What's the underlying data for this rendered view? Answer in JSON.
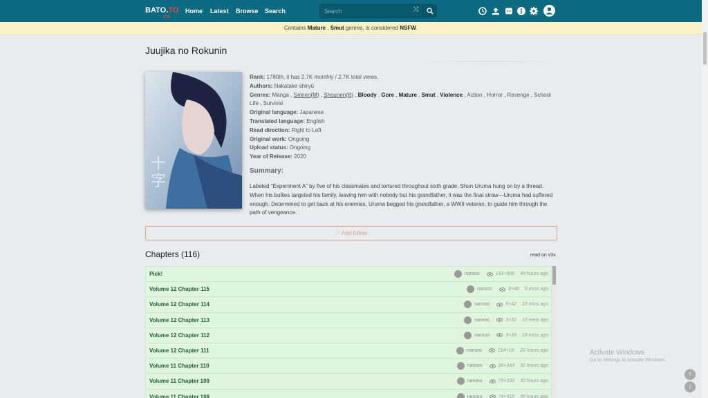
{
  "nav": {
    "logo_main": "BATO.",
    "logo_to": "TO",
    "logo_sub": "v3x",
    "links": [
      "Home",
      "Latest",
      "Browse",
      "Search"
    ],
    "search_placeholder": "Search"
  },
  "notice": {
    "pre": "Contains ",
    "g1": "Mature",
    "sep": " , ",
    "g2": "Smut",
    "mid": " genres, is considered ",
    "nsfw": "NSFW",
    "end": "."
  },
  "manga": {
    "title": "Juujika no Rokunin",
    "rank_label": "Rank:",
    "rank_value": "1780th, it has 2.7K monthly / 2.7K total views.",
    "authors_label": "Authors:",
    "authors_value": "Nakatake shiryū",
    "genres_label": "Genres:",
    "genres": [
      {
        "name": "Manga",
        "style": "plain"
      },
      {
        "name": "Seinen(M)",
        "style": "under"
      },
      {
        "name": "Shounen(B)",
        "style": "under"
      },
      {
        "name": "Bloody",
        "style": "bold"
      },
      {
        "name": "Gore",
        "style": "bold"
      },
      {
        "name": "Mature",
        "style": "bold"
      },
      {
        "name": "Smut",
        "style": "bold"
      },
      {
        "name": "Violence",
        "style": "bold"
      },
      {
        "name": "Action",
        "style": "plain"
      },
      {
        "name": "Horror",
        "style": "plain"
      },
      {
        "name": "Revenge",
        "style": "plain"
      },
      {
        "name": "School Life",
        "style": "plain"
      },
      {
        "name": "Survival",
        "style": "plain"
      }
    ],
    "orig_lang_label": "Original language:",
    "orig_lang_value": "Japanese",
    "trans_lang_label": "Translated language:",
    "trans_lang_value": "English",
    "read_dir_label": "Read direction:",
    "read_dir_value": "Right to Left",
    "orig_work_label": "Original work:",
    "orig_work_value": "Ongoing",
    "upload_label": "Upload status:",
    "upload_value": "Ongoing",
    "year_label": "Year of Release:",
    "year_value": "2020",
    "summary_title": "Summary:",
    "summary": "Labeled \"Experiment A\" by five of his classmates and tortured throughout sixth grade, Shun Uruma hung on by a thread. When his bullies targeted his family, leaving him with nobody but his grandfather, it was the final straw—Uruma had suffered enough. Determined to get back at his enemies, Uruma begged his grandfather, a WWII veteran, to guide him through the path of vengeance.",
    "follow_label": "♡ Add follow"
  },
  "chapters": {
    "title": "Chapters (116)",
    "read_on": "read on v3x",
    "rows": [
      {
        "name": "Pick!",
        "user": "narooo",
        "views": "193+808",
        "time": "49 hours ago"
      },
      {
        "name": "Volume 12 Chapter 115",
        "user": "narooo",
        "views": "8+48",
        "time": "9 mins ago"
      },
      {
        "name": "Volume 12 Chapter 114",
        "user": "narooo",
        "views": "5+42",
        "time": "13 mins ago"
      },
      {
        "name": "Volume 12 Chapter 113",
        "user": "narooo",
        "views": "3+32",
        "time": "15 mins ago"
      },
      {
        "name": "Volume 12 Chapter 112",
        "user": "narooo",
        "views": "3+39",
        "time": "19 mins ago"
      },
      {
        "name": "Volume 12 Chapter 111",
        "user": "narooo",
        "views": "194+1K",
        "time": "20 hours ago"
      },
      {
        "name": "Volume 11 Chapter 110",
        "user": "narooo",
        "views": "88+343",
        "time": "30 hours ago"
      },
      {
        "name": "Volume 11 Chapter 109",
        "user": "narooo",
        "views": "79+330",
        "time": "30 hours ago"
      },
      {
        "name": "Volume 11 Chapter 108",
        "user": "narooo",
        "views": "74+315",
        "time": "30 hours ago"
      }
    ]
  },
  "watermark": {
    "line1": "Activate Windows",
    "line2": "Go to Settings to activate Windows."
  },
  "colors": {
    "nav": "#0c6a82",
    "row": "#e0f5de",
    "chapter_text": "#1d5e3a"
  }
}
